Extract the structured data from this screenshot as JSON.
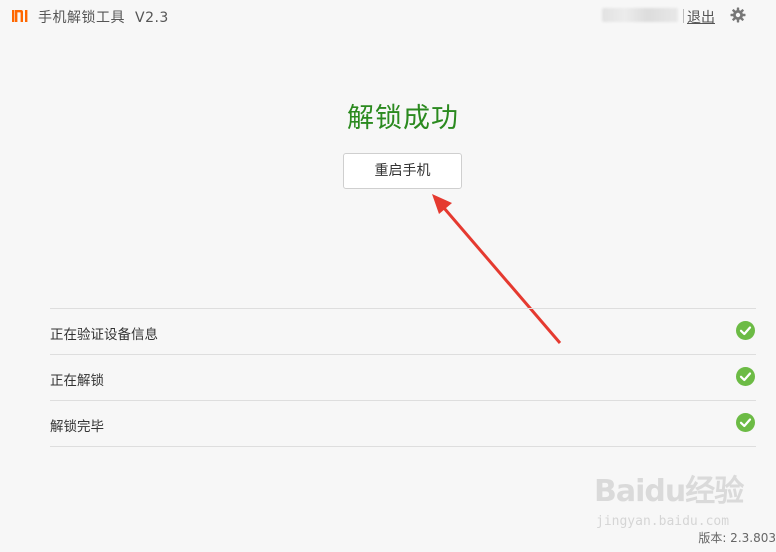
{
  "titlebar": {
    "logo_icon": "mi-logo-icon",
    "app_title": "手机解锁工具",
    "version": "V2.3",
    "logout_label": "退出",
    "settings_icon": "gear-icon"
  },
  "main": {
    "status_title": "解锁成功",
    "reboot_button_label": "重启手机"
  },
  "steps": [
    {
      "label": "正在验证设备信息",
      "status": "complete",
      "icon": "check-circle-icon"
    },
    {
      "label": "正在解锁",
      "status": "complete",
      "icon": "check-circle-icon"
    },
    {
      "label": "解锁完毕",
      "status": "complete",
      "icon": "check-circle-icon"
    }
  ],
  "footer": {
    "version_label": "版本: 2.3.803"
  },
  "watermark": {
    "brand": "Baidu经验",
    "url": "jingyan.baidu.com"
  },
  "colors": {
    "accent_orange": "#ff6700",
    "success_green": "#2b8a1f",
    "check_green": "#6cbb45",
    "annotation_arrow": "#e53a30"
  }
}
